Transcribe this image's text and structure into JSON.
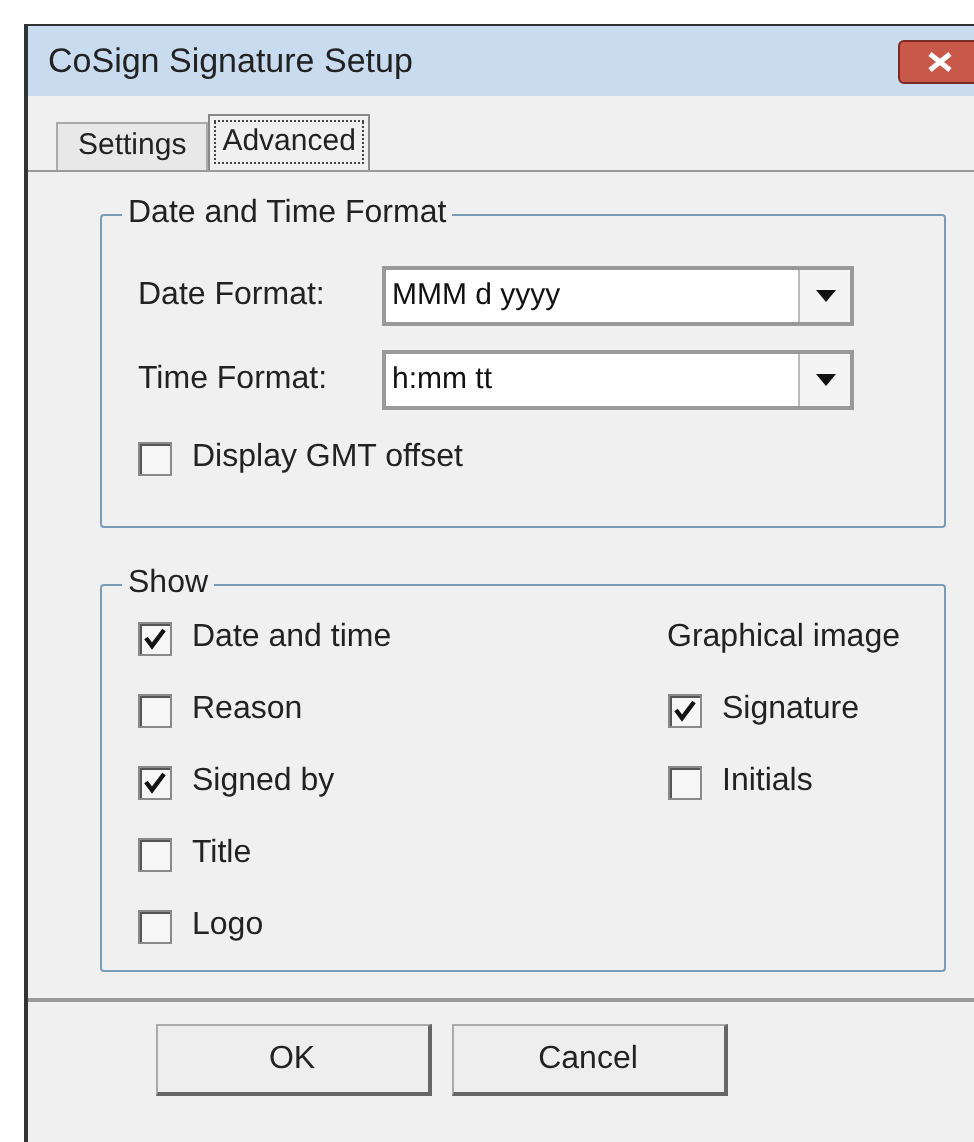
{
  "window": {
    "title": "CoSign Signature Setup"
  },
  "tabs": [
    {
      "label": "Settings",
      "selected": false
    },
    {
      "label": "Advanced",
      "selected": true
    }
  ],
  "date_time_format": {
    "title": "Date and Time Format",
    "fields": [
      {
        "label": "Date Format:",
        "value": "MMM d yyyy"
      },
      {
        "label": "Time Format:",
        "value": "h:mm tt"
      }
    ],
    "gmt_offset": {
      "label": "Display GMT offset",
      "checked": false
    }
  },
  "show": {
    "title": "Show",
    "items": [
      {
        "label": "Date and time",
        "checked": true
      },
      {
        "label": "Reason",
        "checked": false
      },
      {
        "label": "Signed by",
        "checked": true
      },
      {
        "label": "Title",
        "checked": false
      },
      {
        "label": "Logo",
        "checked": false
      }
    ],
    "graphical_image": {
      "title": "Graphical image",
      "items": [
        {
          "label": "Signature",
          "checked": true
        },
        {
          "label": "Initials",
          "checked": false
        }
      ]
    }
  },
  "buttons": [
    "OK",
    "Cancel"
  ]
}
